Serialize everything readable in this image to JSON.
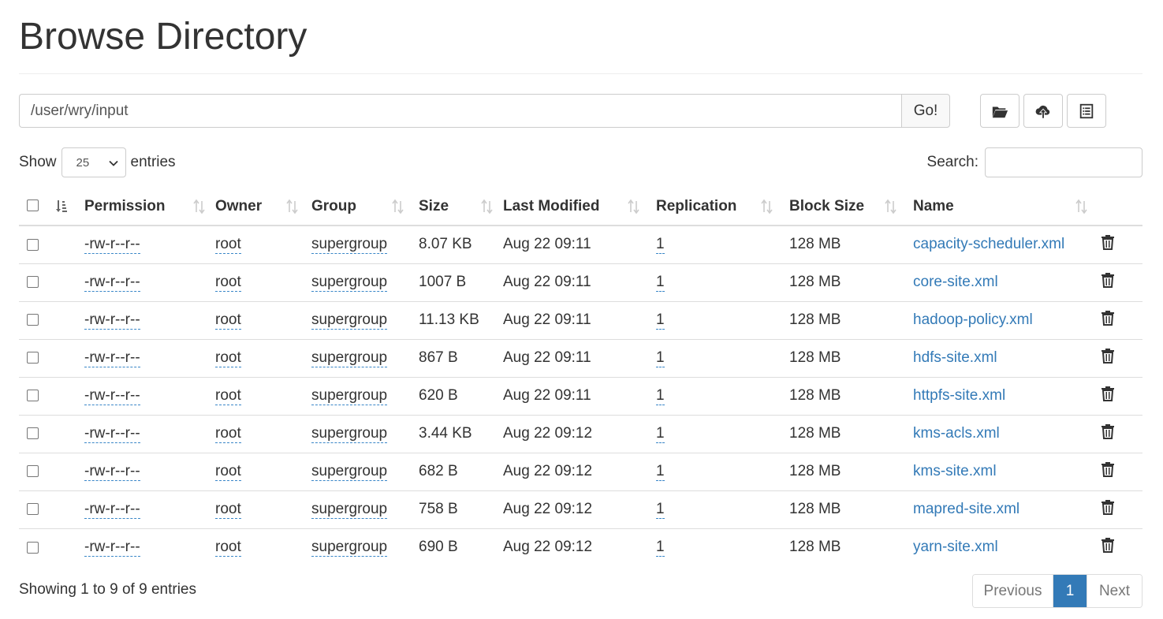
{
  "page": {
    "title": "Browse Directory"
  },
  "pathbar": {
    "path_value": "/user/wry/input",
    "go_label": "Go!"
  },
  "toolbar": {
    "icons": [
      "folder-open-icon",
      "cloud-upload-icon",
      "list-alt-icon"
    ]
  },
  "controls": {
    "show_label": "Show",
    "entries_value": "25",
    "entries_label": "entries",
    "search_label": "Search:",
    "search_value": ""
  },
  "table": {
    "headers": {
      "permission": "Permission",
      "owner": "Owner",
      "group": "Group",
      "size": "Size",
      "last_modified": "Last Modified",
      "replication": "Replication",
      "block_size": "Block Size",
      "name": "Name"
    },
    "rows": [
      {
        "permission": "-rw-r--r--",
        "owner": "root",
        "group": "supergroup",
        "size": "8.07 KB",
        "modified": "Aug 22 09:11",
        "replication": "1",
        "block_size": "128 MB",
        "name": "capacity-scheduler.xml"
      },
      {
        "permission": "-rw-r--r--",
        "owner": "root",
        "group": "supergroup",
        "size": "1007 B",
        "modified": "Aug 22 09:11",
        "replication": "1",
        "block_size": "128 MB",
        "name": "core-site.xml"
      },
      {
        "permission": "-rw-r--r--",
        "owner": "root",
        "group": "supergroup",
        "size": "11.13 KB",
        "modified": "Aug 22 09:11",
        "replication": "1",
        "block_size": "128 MB",
        "name": "hadoop-policy.xml"
      },
      {
        "permission": "-rw-r--r--",
        "owner": "root",
        "group": "supergroup",
        "size": "867 B",
        "modified": "Aug 22 09:11",
        "replication": "1",
        "block_size": "128 MB",
        "name": "hdfs-site.xml"
      },
      {
        "permission": "-rw-r--r--",
        "owner": "root",
        "group": "supergroup",
        "size": "620 B",
        "modified": "Aug 22 09:11",
        "replication": "1",
        "block_size": "128 MB",
        "name": "httpfs-site.xml"
      },
      {
        "permission": "-rw-r--r--",
        "owner": "root",
        "group": "supergroup",
        "size": "3.44 KB",
        "modified": "Aug 22 09:12",
        "replication": "1",
        "block_size": "128 MB",
        "name": "kms-acls.xml"
      },
      {
        "permission": "-rw-r--r--",
        "owner": "root",
        "group": "supergroup",
        "size": "682 B",
        "modified": "Aug 22 09:12",
        "replication": "1",
        "block_size": "128 MB",
        "name": "kms-site.xml"
      },
      {
        "permission": "-rw-r--r--",
        "owner": "root",
        "group": "supergroup",
        "size": "758 B",
        "modified": "Aug 22 09:12",
        "replication": "1",
        "block_size": "128 MB",
        "name": "mapred-site.xml"
      },
      {
        "permission": "-rw-r--r--",
        "owner": "root",
        "group": "supergroup",
        "size": "690 B",
        "modified": "Aug 22 09:12",
        "replication": "1",
        "block_size": "128 MB",
        "name": "yarn-site.xml"
      }
    ]
  },
  "footer": {
    "info": "Showing 1 to 9 of 9 entries",
    "previous_label": "Previous",
    "current_page": "1",
    "next_label": "Next"
  },
  "colors": {
    "link": "#337ab7",
    "active_page": "#337ab7",
    "border": "#dddddd"
  }
}
